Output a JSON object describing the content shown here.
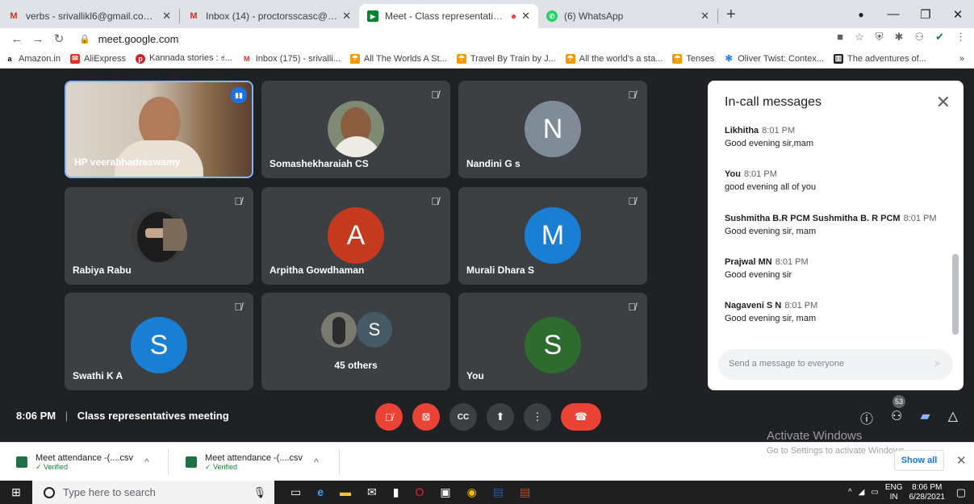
{
  "browser": {
    "tabs": [
      {
        "title": "verbs - srivallikl6@gmail.com - G",
        "icon": "gmail-icon"
      },
      {
        "title": "Inbox (14) - proctorsscasc@gmai",
        "icon": "gmail-icon"
      },
      {
        "title": "Meet - Class representatives",
        "icon": "meet-icon"
      },
      {
        "title": "(6) WhatsApp",
        "icon": "whatsapp-icon"
      }
    ],
    "url": "meet.google.com",
    "bookmarks": [
      "Amazon.in",
      "AliExpress",
      "Kannada stories : ಕ...",
      "Inbox (175) - srivalli...",
      "All The Worlds A St...",
      "Travel By Train by J...",
      "All the world's a sta...",
      "Tenses",
      "Oliver Twist: Contex...",
      "The adventures of..."
    ]
  },
  "meet": {
    "tiles": [
      {
        "name": "HP veerabhadraswamy",
        "type": "video"
      },
      {
        "name": "Somashekharaiah CS",
        "type": "photo"
      },
      {
        "name": "Nandini G s",
        "initial": "N",
        "color": "#7f8c98"
      },
      {
        "name": "Rabiya Rabu",
        "type": "photo"
      },
      {
        "name": "Arpitha Gowdhaman",
        "initial": "A",
        "color": "#c5391f"
      },
      {
        "name": "Murali Dhara S",
        "initial": "M",
        "color": "#1a7fd4"
      },
      {
        "name": "Swathi K A",
        "initial": "S",
        "color": "#1a7fd4"
      },
      {
        "name": "45 others",
        "initial": "S",
        "color": "#455a64"
      },
      {
        "name": "You",
        "initial": "S",
        "color": "#2e6b2e"
      }
    ],
    "chat": {
      "title": "In-call messages",
      "messages": [
        {
          "sender": "Likhitha",
          "time": "8:01 PM",
          "text": "Good evening sir,mam"
        },
        {
          "sender": "You",
          "time": "8:01 PM",
          "text": "good evening all of you"
        },
        {
          "sender": "Sushmitha B.R PCM Sushmitha B. R PCM",
          "time": "8:01 PM",
          "text": "Good evening sir, mam"
        },
        {
          "sender": "Prajwal MN",
          "time": "8:01 PM",
          "text": "Good evening sir"
        },
        {
          "sender": "Nagaveni S N",
          "time": "8:01 PM",
          "text": "Good evening sir, mam"
        }
      ],
      "placeholder": "Send a message to everyone"
    },
    "time": "8:06 PM",
    "separator": "|",
    "meeting_name": "Class representatives meeting",
    "participant_count": "53"
  },
  "downloads": {
    "items": [
      {
        "name": "Meet attendance -(....csv",
        "status": "Verified"
      },
      {
        "name": "Meet attendance -(....csv",
        "status": "Verified"
      }
    ],
    "show_all": "Show all"
  },
  "watermark": {
    "title": "Activate Windows",
    "subtitle": "Go to Settings to activate Windows."
  },
  "taskbar": {
    "search_placeholder": "Type here to search",
    "lang": "ENG",
    "region": "IN",
    "time": "8:06 PM",
    "date": "6/28/2021"
  }
}
